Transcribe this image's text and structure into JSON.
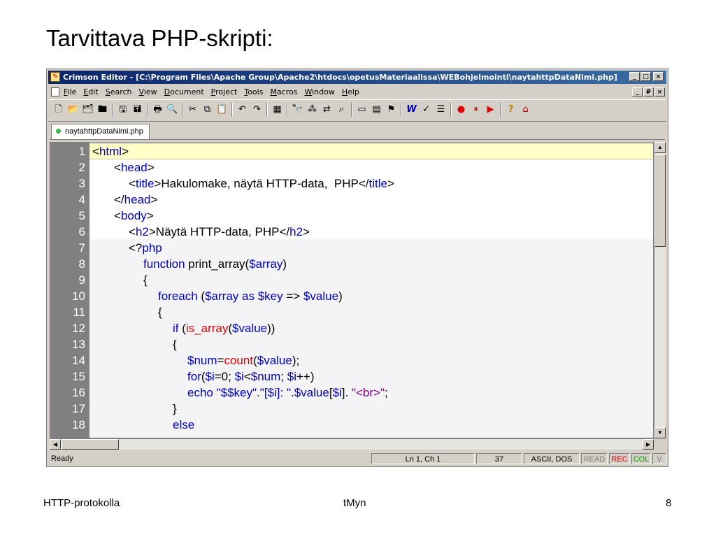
{
  "slide": {
    "title": "Tarvittava PHP-skripti:",
    "footer_left": "HTTP-protokolla",
    "footer_center": "tMyn",
    "footer_page": "8"
  },
  "window": {
    "title": "Crimson Editor - [C:\\Program Files\\Apache Group\\Apache2\\htdocs\\opetusMateriaalissa\\WEBohjelmointi\\naytahttpDataNimi.php]",
    "app_icon": "crimson-editor-icon",
    "minimize": "_",
    "maximize": "□",
    "restore": "₽",
    "close": "×"
  },
  "menu": [
    "File",
    "Edit",
    "Search",
    "View",
    "Document",
    "Project",
    "Tools",
    "Macros",
    "Window",
    "Help"
  ],
  "toolbar": [
    {
      "icon": "new-file-icon",
      "glyph": "🗋"
    },
    {
      "icon": "open-file-icon",
      "glyph": "📂"
    },
    {
      "icon": "open-project-icon",
      "glyph": "🗂"
    },
    {
      "icon": "open-remote-icon",
      "glyph": "🖿"
    },
    {
      "sep": true
    },
    {
      "icon": "save-icon",
      "glyph": "🖫"
    },
    {
      "icon": "save-all-icon",
      "glyph": "🖬"
    },
    {
      "sep": true
    },
    {
      "icon": "print-icon",
      "glyph": "🖶"
    },
    {
      "icon": "print-preview-icon",
      "glyph": "🔍"
    },
    {
      "sep": true
    },
    {
      "icon": "cut-icon",
      "glyph": "✂"
    },
    {
      "icon": "copy-icon",
      "glyph": "⧉"
    },
    {
      "icon": "paste-icon",
      "glyph": "📋"
    },
    {
      "sep": true
    },
    {
      "icon": "undo-icon",
      "glyph": "↶"
    },
    {
      "icon": "redo-icon",
      "glyph": "↷"
    },
    {
      "sep": true
    },
    {
      "icon": "column-mode-icon",
      "glyph": "▦"
    },
    {
      "sep": true
    },
    {
      "icon": "find-icon",
      "glyph": "🔭"
    },
    {
      "icon": "find-next-icon",
      "glyph": "⁂"
    },
    {
      "icon": "replace-icon",
      "glyph": "⇄"
    },
    {
      "icon": "find-in-files-icon",
      "glyph": "⌕"
    },
    {
      "sep": true
    },
    {
      "icon": "toggle-output-icon",
      "glyph": "▭"
    },
    {
      "icon": "toggle-directory-icon",
      "glyph": "▤"
    },
    {
      "icon": "toggle-bookmark-icon",
      "glyph": "⚑"
    },
    {
      "sep": true
    },
    {
      "icon": "word-wrap-icon",
      "glyph": "W"
    },
    {
      "icon": "spell-check-icon",
      "glyph": "✓"
    },
    {
      "icon": "line-numbers-icon",
      "glyph": "☰"
    },
    {
      "sep": true
    },
    {
      "icon": "record-macro-icon",
      "glyph": "●"
    },
    {
      "icon": "pause-macro-icon",
      "glyph": "⏸"
    },
    {
      "icon": "play-macro-icon",
      "glyph": "▶"
    },
    {
      "sep": true
    },
    {
      "icon": "help-icon",
      "glyph": "?"
    },
    {
      "icon": "home-icon",
      "glyph": "⌂"
    }
  ],
  "tab": {
    "label": "naytahttpDataNimi.php"
  },
  "code_lines": [
    {
      "n": "1",
      "indent": 0,
      "parts": [
        [
          "t",
          "<"
        ],
        [
          "kw",
          "html"
        ],
        [
          "t",
          ">"
        ]
      ],
      "current": true
    },
    {
      "n": "2",
      "indent": 1,
      "parts": [
        [
          "t",
          "<"
        ],
        [
          "kw",
          "head"
        ],
        [
          "t",
          ">"
        ]
      ]
    },
    {
      "n": "3",
      "indent": 2,
      "parts": [
        [
          "t",
          "<"
        ],
        [
          "kw",
          "title"
        ],
        [
          "t",
          ">Hakulomake, näytä HTTP-data,  PHP</"
        ],
        [
          "kw",
          "title"
        ],
        [
          "t",
          ">"
        ]
      ]
    },
    {
      "n": "4",
      "indent": 1,
      "parts": [
        [
          "t",
          "</"
        ],
        [
          "kw",
          "head"
        ],
        [
          "t",
          ">"
        ]
      ]
    },
    {
      "n": "5",
      "indent": 1,
      "parts": [
        [
          "t",
          "<"
        ],
        [
          "kw",
          "body"
        ],
        [
          "t",
          ">"
        ]
      ]
    },
    {
      "n": "6",
      "indent": 2,
      "parts": [
        [
          "t",
          "<"
        ],
        [
          "kw",
          "h2"
        ],
        [
          "t",
          ">Näytä HTTP-data, PHP</"
        ],
        [
          "kw",
          "h2"
        ],
        [
          "t",
          ">"
        ]
      ]
    },
    {
      "n": "7",
      "indent": 2,
      "parts": [
        [
          "t",
          "<?"
        ],
        [
          "kw",
          "php"
        ]
      ]
    },
    {
      "n": "8",
      "indent": 3,
      "parts": [
        [
          "kw",
          "function"
        ],
        [
          "t",
          " print_array("
        ],
        [
          "kw",
          "$array"
        ],
        [
          "t",
          ")"
        ]
      ]
    },
    {
      "n": "9",
      "indent": 3,
      "parts": [
        [
          "t",
          "{"
        ]
      ]
    },
    {
      "n": "10",
      "indent": 4,
      "parts": [
        [
          "kw",
          "foreach"
        ],
        [
          "t",
          " ("
        ],
        [
          "kw",
          "$array"
        ],
        [
          "t",
          " "
        ],
        [
          "kw",
          "as"
        ],
        [
          "t",
          " "
        ],
        [
          "kw",
          "$key"
        ],
        [
          "t",
          " => "
        ],
        [
          "kw",
          "$value"
        ],
        [
          "t",
          ")"
        ]
      ]
    },
    {
      "n": "11",
      "indent": 4,
      "parts": [
        [
          "t",
          "{"
        ]
      ]
    },
    {
      "n": "12",
      "indent": 5,
      "parts": [
        [
          "kw",
          "if"
        ],
        [
          "t",
          " ("
        ],
        [
          "fn",
          "is_array"
        ],
        [
          "t",
          "("
        ],
        [
          "kw",
          "$value"
        ],
        [
          "t",
          "))"
        ]
      ]
    },
    {
      "n": "13",
      "indent": 5,
      "parts": [
        [
          "t",
          "{"
        ]
      ]
    },
    {
      "n": "14",
      "indent": 6,
      "parts": [
        [
          "kw",
          "$num"
        ],
        [
          "t",
          "="
        ],
        [
          "fn",
          "count"
        ],
        [
          "t",
          "("
        ],
        [
          "kw",
          "$value"
        ],
        [
          "t",
          ");"
        ]
      ]
    },
    {
      "n": "15",
      "indent": 6,
      "parts": [
        [
          "kw",
          "for"
        ],
        [
          "t",
          "("
        ],
        [
          "kw",
          "$i"
        ],
        [
          "t",
          "=0; "
        ],
        [
          "kw",
          "$i"
        ],
        [
          "t",
          "<"
        ],
        [
          "kw",
          "$num"
        ],
        [
          "t",
          "; "
        ],
        [
          "kw",
          "$i"
        ],
        [
          "t",
          "++)"
        ]
      ]
    },
    {
      "n": "16",
      "indent": 6,
      "parts": [
        [
          "kw",
          "echo"
        ],
        [
          "t",
          " "
        ],
        [
          "kw",
          "\"$$key\""
        ],
        [
          "t",
          "."
        ],
        [
          "kw",
          "\"[$i]: \""
        ],
        [
          "t",
          "."
        ],
        [
          "kw",
          "$value"
        ],
        [
          "t",
          "["
        ],
        [
          "kw",
          "$i"
        ],
        [
          "t",
          "]. "
        ],
        [
          "str2",
          "\"<br>\""
        ],
        [
          "t",
          ";"
        ]
      ]
    },
    {
      "n": "17",
      "indent": 5,
      "parts": [
        [
          "t",
          "}"
        ]
      ]
    },
    {
      "n": "18",
      "indent": 5,
      "parts": [
        [
          "kw",
          "else"
        ]
      ]
    }
  ],
  "status": {
    "ready": "Ready",
    "position": "Ln 1, Ch 1",
    "col_value": "37",
    "encoding": "ASCII, DOS",
    "read": "READ",
    "rec": "REC",
    "col": "COL",
    "ovr": "V"
  }
}
